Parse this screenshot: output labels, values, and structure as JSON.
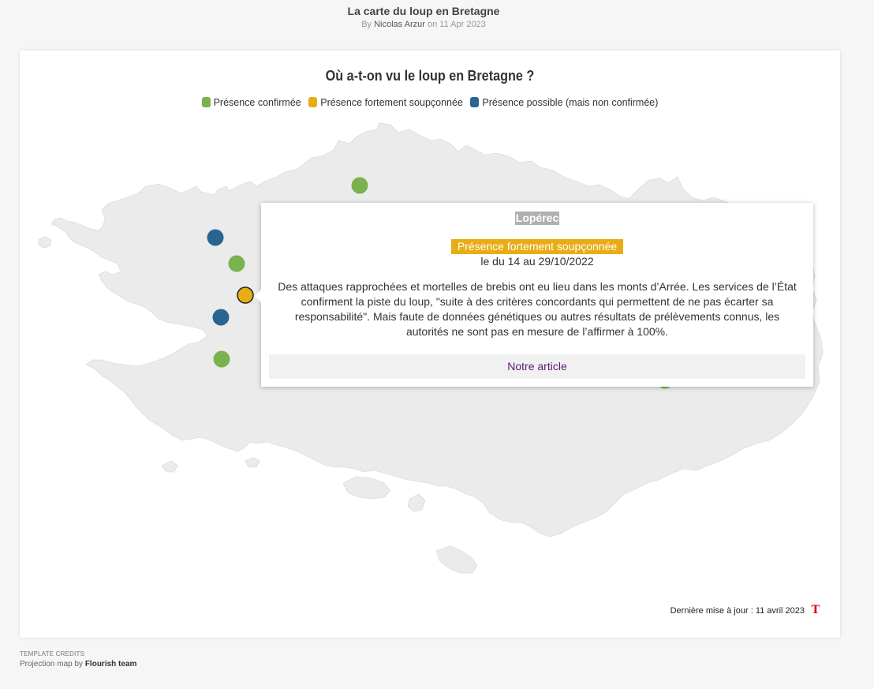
{
  "page": {
    "title": "La carte du loup en Bretagne",
    "byline_prefix": "By",
    "author": "Nicolas Arzur",
    "date_prefix": "on",
    "date": "11 Apr 2023"
  },
  "visualisation": {
    "title": "Où a-t-on vu le loup en Bretagne ?",
    "legend": [
      {
        "label": "Présence confirmée",
        "color": "#7ab24e"
      },
      {
        "label": "Présence fortement soupçonnée",
        "color": "#e8ad14"
      },
      {
        "label": "Présence possible (mais non confirmée)",
        "color": "#2a6592"
      }
    ],
    "land_color": "#ebebeb",
    "tooltip": {
      "place": "Lopérec",
      "status": "Présence fortement soupçonnée",
      "status_color": "#e8ad14",
      "date": "le du 14 au 29/10/2022",
      "description": "Des attaques rapprochées et mortelles de brebis ont eu lieu dans les monts d’Arrée. Les services de l’État confirment la piste du loup, \"suite à des critères concordants qui permettent de ne pas écarter sa responsabilité\". Mais faute de données génétiques ou autres résultats de prélèvements connus, les autorités ne sont pas en mesure de l’affirmer à 100%.",
      "link": "Notre article"
    },
    "footer_update": "Dernière mise à jour : 11 avril 2023",
    "brand_logo": "T"
  },
  "credits": {
    "heading": "Template credits",
    "line_prefix": "Projection map by",
    "line_author": "Flourish team"
  }
}
